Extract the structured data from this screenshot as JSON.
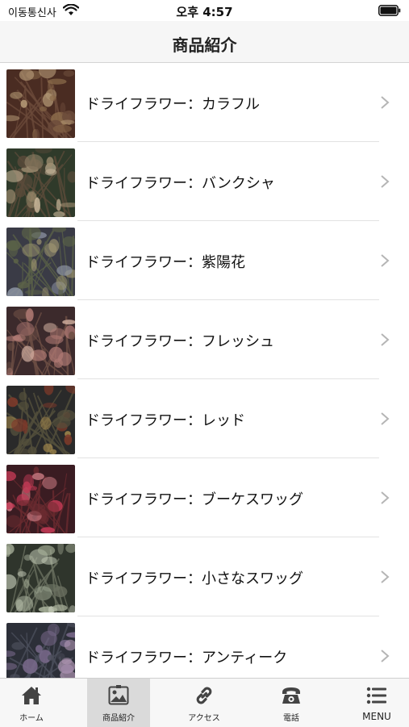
{
  "status_bar": {
    "carrier": "이동통신사",
    "time": "오후 4:57"
  },
  "navbar": {
    "title": "商品紹介"
  },
  "list": {
    "items": [
      {
        "label": "ドライフラワー：カラフル",
        "thumb_colors": [
          "#4a2c22",
          "#8a6a4a",
          "#b59a76",
          "#6b4a3a"
        ]
      },
      {
        "label": "ドライフラワー：バンクシャ",
        "thumb_colors": [
          "#2f3a2a",
          "#9c8b6e",
          "#c9b79a",
          "#5a4b3a"
        ]
      },
      {
        "label": "ドライフラワー：紫陽花",
        "thumb_colors": [
          "#3a3b46",
          "#8f96a6",
          "#a39a72",
          "#5b6248"
        ]
      },
      {
        "label": "ドライフラワー：フレッシュ",
        "thumb_colors": [
          "#3c2a2c",
          "#b07a74",
          "#d6b3a3",
          "#6d4f45"
        ]
      },
      {
        "label": "ドライフラワー：レッド",
        "thumb_colors": [
          "#2a2a2a",
          "#a88c4e",
          "#7d3a2a",
          "#54503c"
        ]
      },
      {
        "label": "ドライフラワー：ブーケスワッグ",
        "thumb_colors": [
          "#3a1c22",
          "#c23a55",
          "#d17f87",
          "#6b2b30"
        ]
      },
      {
        "label": "ドライフラワー：小さなスワッグ",
        "thumb_colors": [
          "#2f352c",
          "#a7b09a",
          "#c2c9b6",
          "#6a7060"
        ]
      },
      {
        "label": "ドライフラワー：アンティーク",
        "thumb_colors": [
          "#2c2f38",
          "#7a6a8c",
          "#b49ab8",
          "#4c4f5c"
        ]
      }
    ]
  },
  "tabbar": {
    "tabs": [
      {
        "label": "ホーム",
        "icon": "home-icon",
        "active": false
      },
      {
        "label": "商品紹介",
        "icon": "image-icon",
        "active": true
      },
      {
        "label": "アクセス",
        "icon": "link-icon",
        "active": false
      },
      {
        "label": "電話",
        "icon": "phone-icon",
        "active": false
      },
      {
        "label": "MENU",
        "icon": "menu-icon",
        "active": false
      }
    ]
  }
}
